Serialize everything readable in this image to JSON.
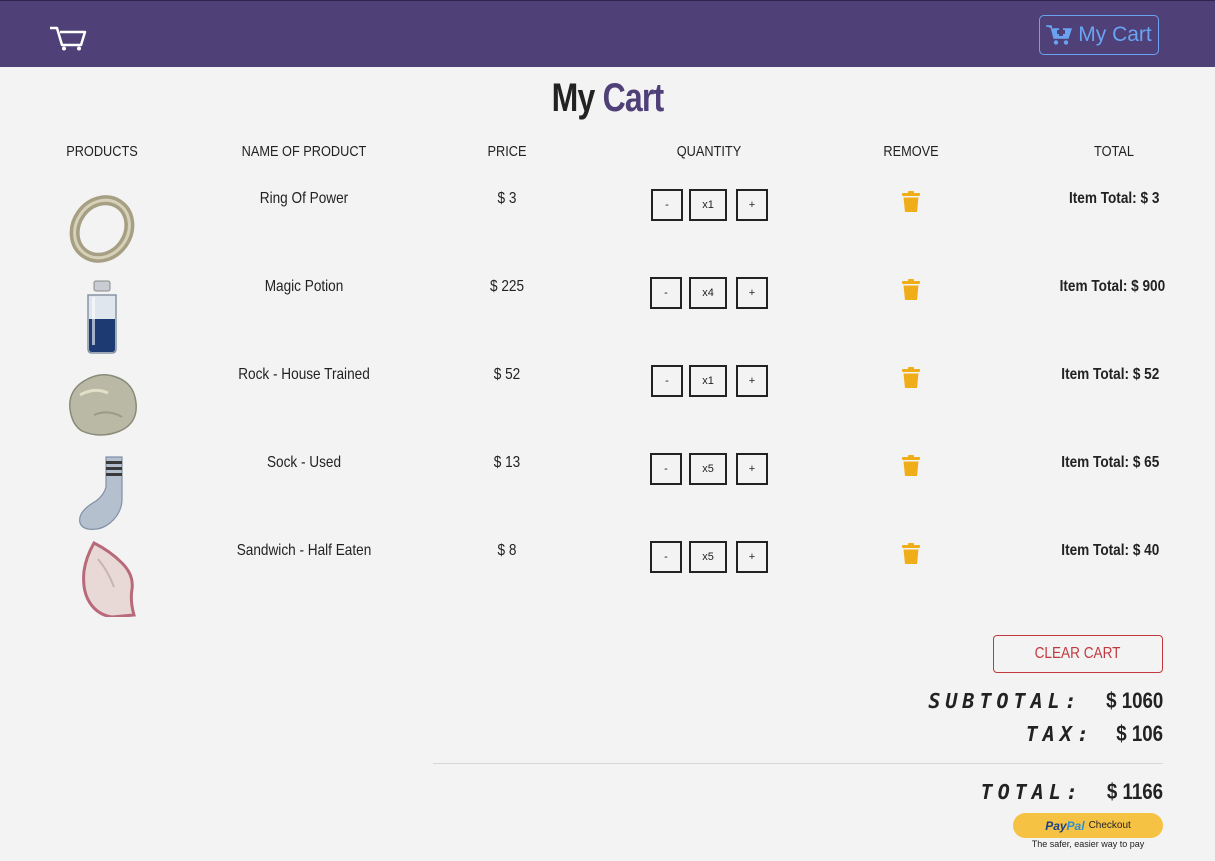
{
  "nav": {
    "cart_button_label": "My Cart"
  },
  "page": {
    "title_part1": "My",
    "title_part2": "Cart"
  },
  "table": {
    "headers": [
      "Products",
      "Name of Product",
      "Price",
      "Quantity",
      "Remove",
      "Total"
    ]
  },
  "quantity_controls": {
    "minus": "-",
    "plus": "+"
  },
  "items": [
    {
      "name": "Ring Of Power",
      "price": "$ 3",
      "qty": "x1",
      "total": "Item Total: $ 3",
      "image": "ring"
    },
    {
      "name": "Magic Potion",
      "price": "$ 225",
      "qty": "x4",
      "total": "Item Total: $ 900",
      "image": "potion"
    },
    {
      "name": "Rock - House Trained",
      "price": "$ 52",
      "qty": "x1",
      "total": "Item Total: $ 52",
      "image": "rock"
    },
    {
      "name": "Sock - Used",
      "price": "$ 13",
      "qty": "x5",
      "total": "Item Total: $ 65",
      "image": "sock"
    },
    {
      "name": "Sandwich - Half Eaten",
      "price": "$ 8",
      "qty": "x5",
      "total": "Item Total: $ 40",
      "image": "sandwich"
    }
  ],
  "summary": {
    "clear_label": "Clear Cart",
    "subtotal_label": "Subtotal:",
    "subtotal_value": "$ 1060",
    "tax_label": "Tax:",
    "tax_value": "$ 106",
    "total_label": "Total:",
    "total_value": "$ 1166"
  },
  "paypal": {
    "logo_part1": "Pay",
    "logo_part2": "Pal",
    "button_label": "Checkout",
    "tagline": "The safer, easier way to pay"
  },
  "colors": {
    "navbar": "#4f4078",
    "accent": "#4f4078",
    "cart_button": "#6aa3f2",
    "trash": "#f0ad1a",
    "clear_button": "#c0393f",
    "paypal": "#f5c243"
  },
  "icons": [
    "cart-logo-icon",
    "cart-plus-icon",
    "trash-icon"
  ]
}
